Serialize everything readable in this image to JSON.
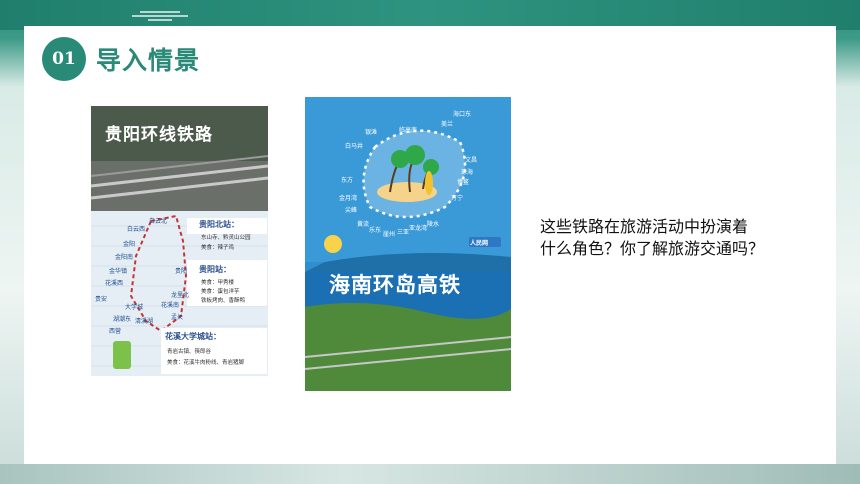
{
  "section": {
    "number": "01",
    "title": "导入情景"
  },
  "poster_guiyang": {
    "title": "贵阳环线铁路",
    "stops": [
      "白云北",
      "白云西",
      "金阳",
      "金阳南",
      "金华镇",
      "花溪西",
      "贵安",
      "湖潮东",
      "西营",
      "大学城",
      "清溪湖",
      "花溪南",
      "孟关",
      "龙里北",
      "贵阳"
    ],
    "info": [
      {
        "station": "贵阳北站：",
        "lines": [
          "东山寺、黔灵山公园",
          "美食：辣子鸡"
        ]
      },
      {
        "station": "贵阳站：",
        "lines": [
          "美食：甲秀楼",
          "美食：蛋包洋芋",
          "铁板烤肉、香酥鸭"
        ]
      },
      {
        "station": "花溪大学城站：",
        "lines": [
          "青岩古镇、筷郎谷",
          "美食：花溪牛肉粉线、青岩猪脚"
        ]
      }
    ]
  },
  "poster_hainan": {
    "title": "海南环岛高铁",
    "logo": "人民网",
    "stops": [
      "海口东",
      "临高南",
      "白马井",
      "银滩",
      "东方",
      "金月湾",
      "尖峰",
      "黄流",
      "乐东",
      "崖州",
      "三亚",
      "亚龙湾",
      "陵水",
      "万宁",
      "博鳌",
      "琼海",
      "文昌",
      "美兰"
    ]
  },
  "question": {
    "line1": "这些铁路在旅游活动中扮演着",
    "line2": "什么角色？你了解旅游交通吗？"
  },
  "colors": {
    "accent": "#2a8a78"
  }
}
